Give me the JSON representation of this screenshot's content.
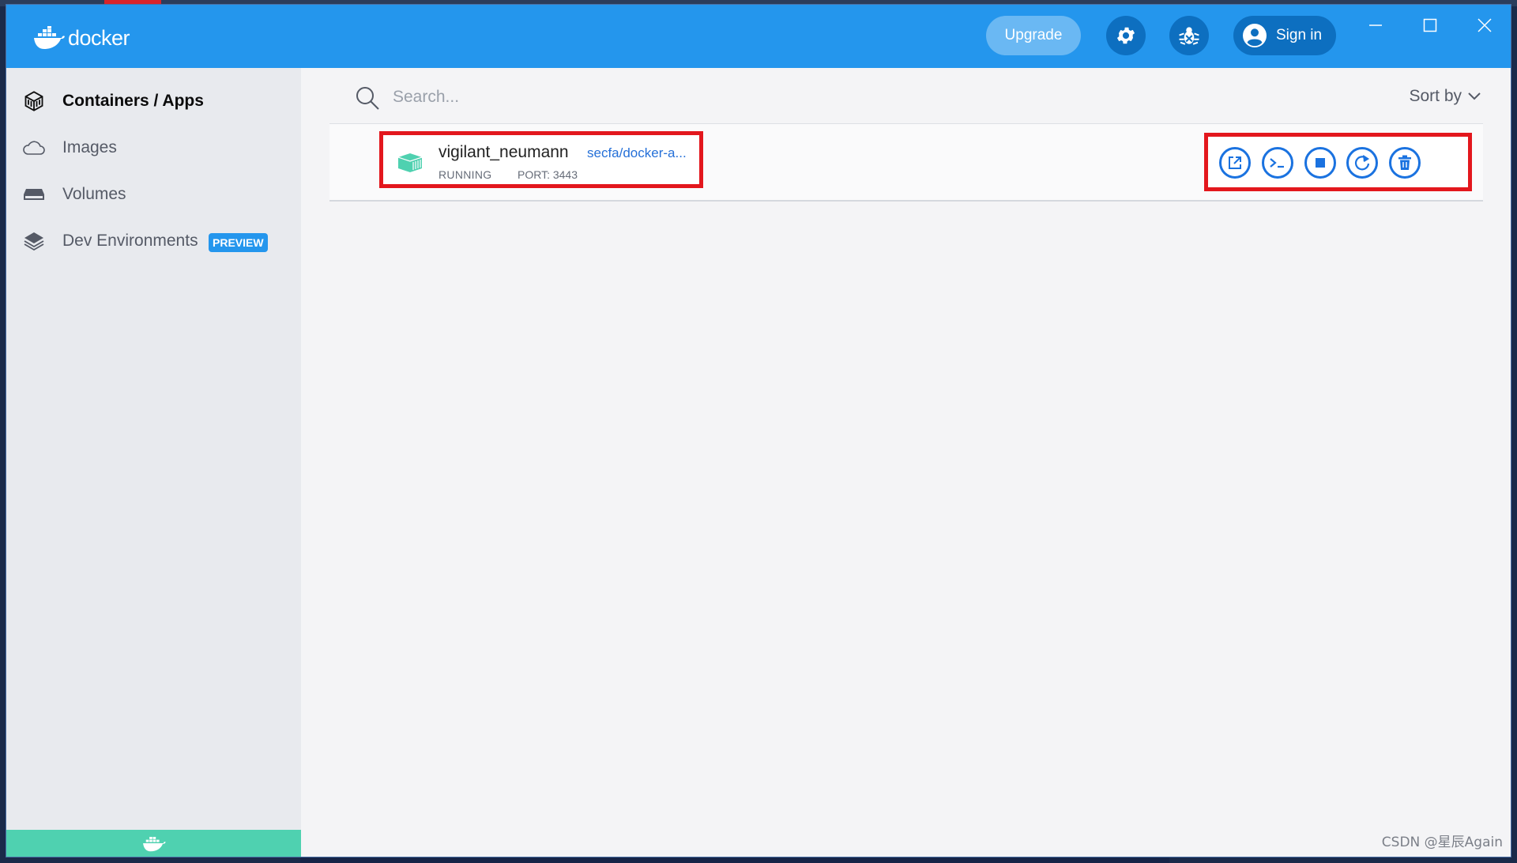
{
  "app": {
    "logo_text": "docker",
    "upgrade_label": "Upgrade",
    "signin_label": "Sign in",
    "brand_color": "#2496ed"
  },
  "sidebar": {
    "items": [
      {
        "label": "Containers / Apps",
        "icon": "container-box-icon",
        "active": true
      },
      {
        "label": "Images",
        "icon": "cloud-icon",
        "active": false
      },
      {
        "label": "Volumes",
        "icon": "hard-drive-icon",
        "active": false
      },
      {
        "label": "Dev Environments",
        "icon": "layers-icon",
        "active": false,
        "badge": "PREVIEW"
      }
    ]
  },
  "main": {
    "search_placeholder": "Search...",
    "sort_label": "Sort by",
    "containers": [
      {
        "name": "vigilant_neumann",
        "image": "secfa/docker-a...",
        "status": "RUNNING",
        "port": "PORT: 3443",
        "status_color": "#4fd1b0",
        "actions": [
          "open-in-browser-icon",
          "cli-icon",
          "stop-icon",
          "restart-icon",
          "delete-icon"
        ]
      }
    ]
  },
  "watermark": "CSDN @星辰Again"
}
